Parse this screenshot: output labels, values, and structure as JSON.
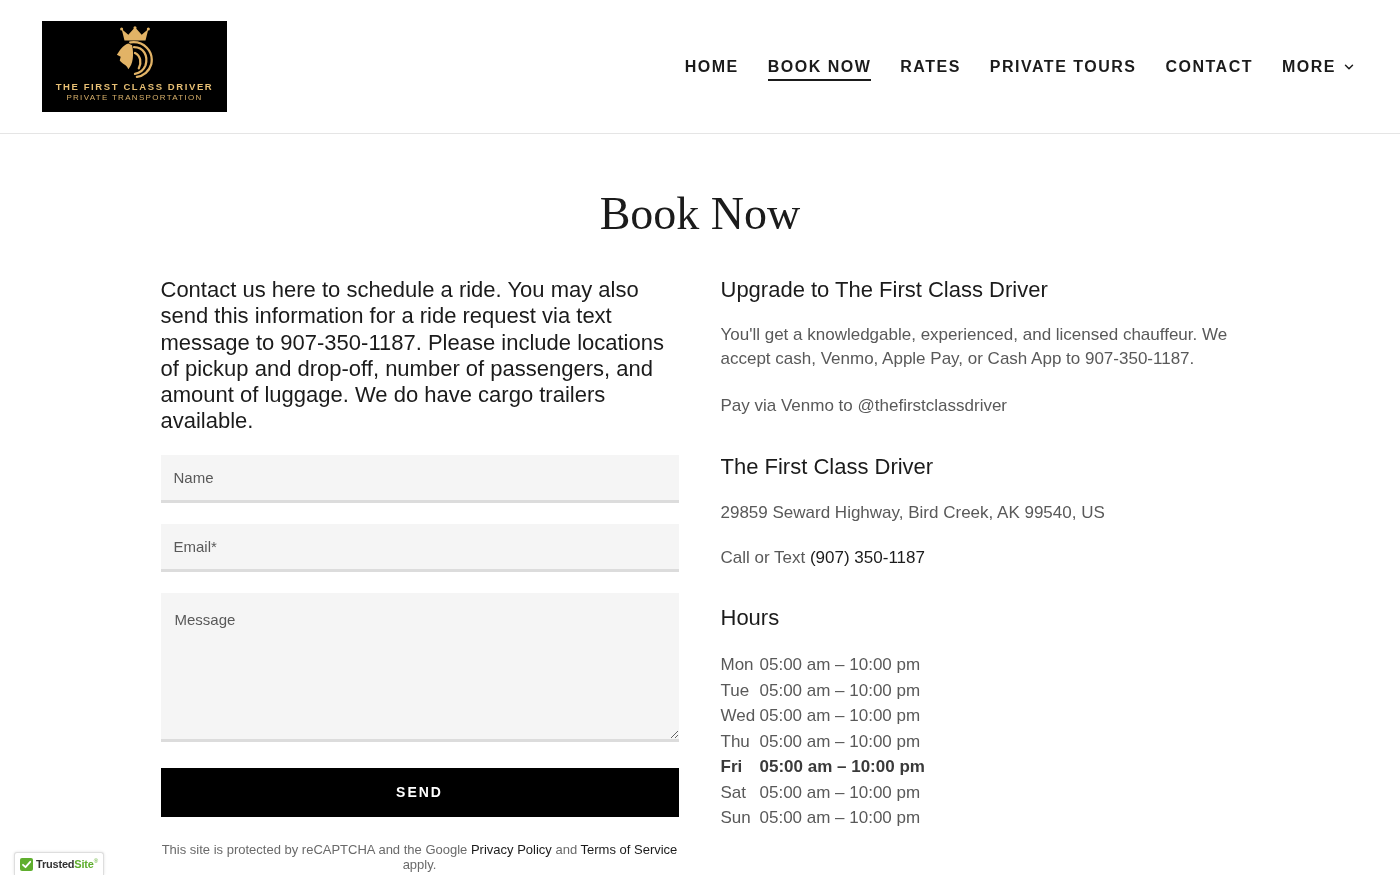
{
  "header": {
    "logo": {
      "title": "THE FIRST CLASS DRIVER",
      "subtitle": "PRIVATE TRANSPORTATION"
    },
    "nav": [
      {
        "label": "HOME",
        "kind": "link",
        "selected": false
      },
      {
        "label": "BOOK NOW",
        "kind": "link",
        "selected": true
      },
      {
        "label": "RATES",
        "kind": "link",
        "selected": false
      },
      {
        "label": "PRIVATE TOURS",
        "kind": "link",
        "selected": false
      },
      {
        "label": "CONTACT",
        "kind": "link",
        "selected": false
      },
      {
        "label": "MORE",
        "kind": "dropdown",
        "selected": false
      }
    ]
  },
  "title": "Book Now",
  "contact_form": {
    "intro": "Contact us here to schedule a ride. You may also send this information for a ride request via text message to 907-350-1187. Please include locations of pickup and drop-off, number of passengers, and amount of luggage. We do have cargo trailers available.",
    "fields": [
      {
        "kind": "input",
        "placeholder": "Name"
      },
      {
        "kind": "input",
        "placeholder": "Email*"
      },
      {
        "kind": "textarea",
        "placeholder": "Message"
      }
    ],
    "submit": "SEND",
    "notice": [
      {
        "kind": "text",
        "text": "This site is protected by reCAPTCHA and the Google "
      },
      {
        "kind": "link",
        "text": "Privacy Policy"
      },
      {
        "kind": "text",
        "text": " and "
      },
      {
        "kind": "link",
        "text": "Terms of Service"
      },
      {
        "kind": "text",
        "text": " apply."
      }
    ]
  },
  "upgrade": {
    "heading": "Upgrade to The First Class Driver",
    "paragraphs": [
      "You'll get a knowledgable, experienced, and licensed chauffeur. We accept cash, Venmo, Apple Pay, or Cash App to 907-350-1187.",
      "Pay via Venmo to @thefirstclassdriver"
    ]
  },
  "business": {
    "heading": "The First Class Driver",
    "address": "29859 Seward Highway, Bird Creek, AK 99540, US",
    "phone_label": "Call or Text",
    "phone": "(907) 350-1187"
  },
  "hours": {
    "heading": "Hours",
    "days": [
      {
        "day": "Mon",
        "time": "05:00 am – 10:00 pm",
        "today": false
      },
      {
        "day": "Tue",
        "time": "05:00 am – 10:00 pm",
        "today": false
      },
      {
        "day": "Wed",
        "time": "05:00 am – 10:00 pm",
        "today": false
      },
      {
        "day": "Thu",
        "time": "05:00 am – 10:00 pm",
        "today": false
      },
      {
        "day": "Fri",
        "time": "05:00 am – 10:00 pm",
        "today": true
      },
      {
        "day": "Sat",
        "time": "05:00 am – 10:00 pm",
        "today": false
      },
      {
        "day": "Sun",
        "time": "05:00 am – 10:00 pm",
        "today": false
      }
    ]
  },
  "trust_badge": {
    "brand": "Trusted",
    "accent": "Site",
    "mark": "®"
  }
}
